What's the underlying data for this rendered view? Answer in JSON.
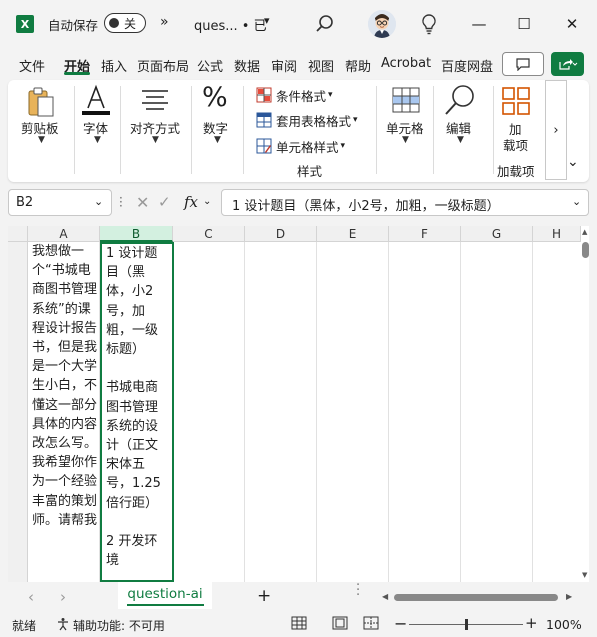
{
  "titlebar": {
    "autosave_label": "自动保存",
    "autosave_state": "关",
    "doc_title": "ques... • 已",
    "more_chevrons": "»",
    "chevron": "▾",
    "window": {
      "minimize": "—",
      "maximize": "☐",
      "close": "✕"
    }
  },
  "tabs": [
    "文件",
    "开始",
    "插入",
    "页面布局",
    "公式",
    "数据",
    "审阅",
    "视图",
    "帮助",
    "Acrobat",
    "百度网盘"
  ],
  "active_tab": "开始",
  "ribbon": {
    "clipboard": "剪贴板",
    "font": "字体",
    "alignment": "对齐方式",
    "number": "数字",
    "styles": {
      "conditional": "条件格式",
      "table": "套用表格格式",
      "cell_styles": "单元格样式",
      "group_label": "样式"
    },
    "cells": "单元格",
    "editing": "编辑",
    "addin_line1": "加",
    "addin_line2": "载项",
    "addin_group": "加载项",
    "scroll_right": "›",
    "collapse": "⌄"
  },
  "formula_bar": {
    "name_box": "B2",
    "content": "1 设计题目（黑体，小2号，加粗，一级标题）"
  },
  "grid": {
    "columns": [
      "A",
      "B",
      "C",
      "D",
      "E",
      "F",
      "G",
      "H"
    ],
    "selected_column": "B",
    "cell_a": "我想做一个“书城电商图书管理系统”的课程设计报告书，但是我是一个大学生小白，不懂这一部分具体的内容改怎么写。我希望你作为一个经验丰富的策划师。请帮我",
    "cell_b_parts": [
      "1 设计题目（黑体，小2号，加粗，一级标题）",
      "书城电商图书管理系统的设计（正文宋体五号，1.25倍行距）",
      "2 开发环境"
    ]
  },
  "sheets": {
    "active": "question-ai",
    "prev": "‹",
    "next": "›",
    "add": "+"
  },
  "status": {
    "ready": "就绪",
    "accessibility": "辅助功能: 不可用",
    "zoom_minus": "−",
    "zoom_plus": "+",
    "zoom": "100%"
  },
  "colors": {
    "accent": "#107c41",
    "ribbon_red": "#c0392b",
    "addin_orange": "#d35400"
  }
}
